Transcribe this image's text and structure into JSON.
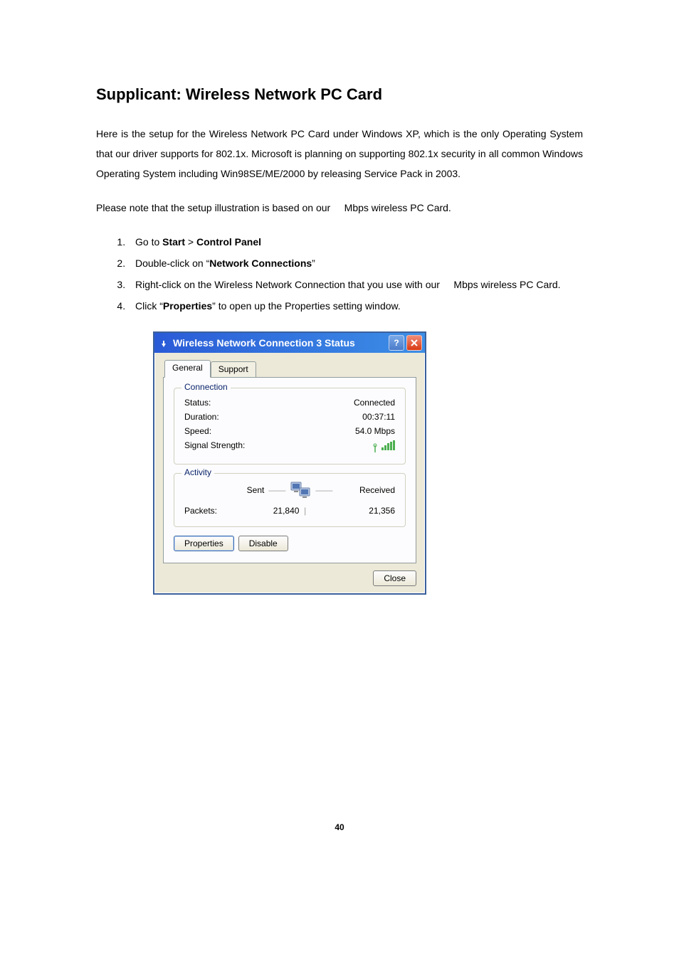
{
  "heading": "Supplicant: Wireless Network PC Card",
  "para1": "Here is the setup for the Wireless Network PC Card under Windows XP, which is the only Operating System that our driver supports for 802.1x.  Microsoft is planning on supporting 802.1x security in all common Windows Operating System including Win98SE/ME/2000 by releasing Service Pack in 2003.",
  "para2_a": "Please note that the setup illustration is based on our ",
  "para2_b": "Mbps wireless PC Card.",
  "list": {
    "item1_a": "Go to ",
    "item1_b": "Start",
    "item1_c": " > ",
    "item1_d": "Control Panel",
    "item2_a": "Double-click on “",
    "item2_b": "Network Connections",
    "item2_c": "”",
    "item3_a": "Right-click on the Wireless Network Connection that you use with our ",
    "item3_b": "Mbps wireless PC Card.",
    "item4_a": "Click “",
    "item4_b": "Properties",
    "item4_c": "” to open up the Properties setting window."
  },
  "dialog": {
    "title": "Wireless Network Connection 3 Status",
    "tabs": {
      "general": "General",
      "support": "Support"
    },
    "connection": {
      "legend": "Connection",
      "status_label": "Status:",
      "status_value": "Connected",
      "duration_label": "Duration:",
      "duration_value": "00:37:11",
      "speed_label": "Speed:",
      "speed_value": "54.0 Mbps",
      "signal_label": "Signal Strength:"
    },
    "activity": {
      "legend": "Activity",
      "sent_label": "Sent",
      "received_label": "Received",
      "packets_label": "Packets:",
      "sent_value": "21,840",
      "received_value": "21,356"
    },
    "buttons": {
      "properties": "Properties",
      "disable": "Disable",
      "close": "Close"
    }
  },
  "page_number": "40"
}
